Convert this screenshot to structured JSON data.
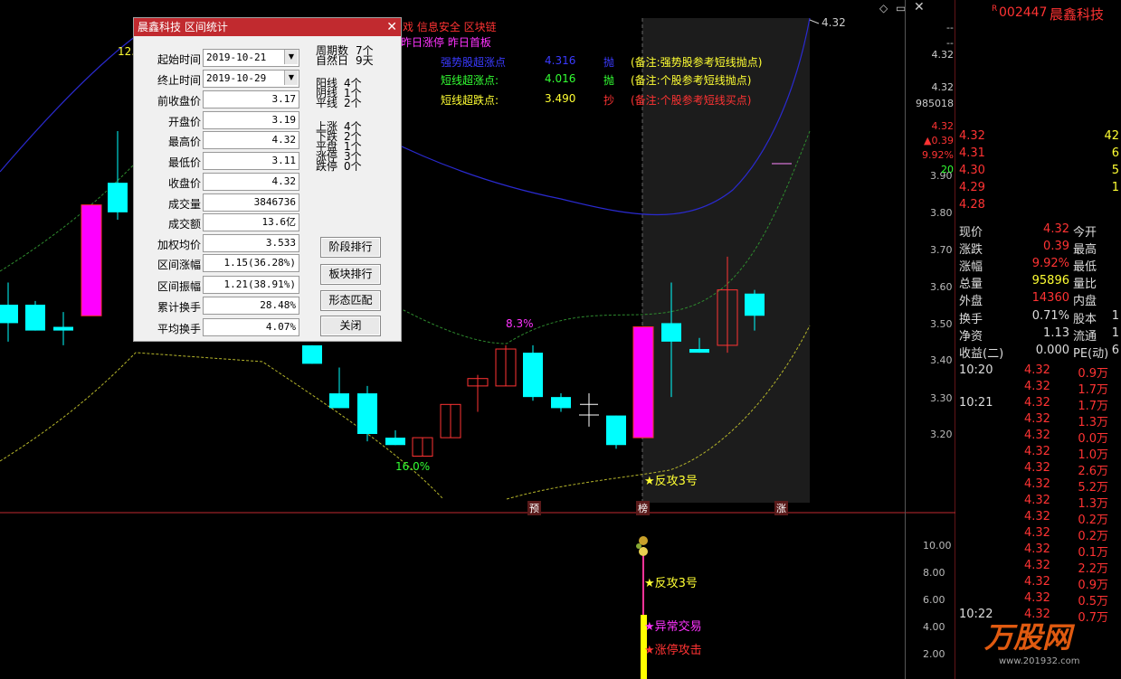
{
  "top_tags": {
    "line1": "戏 信息安全 区块链",
    "line2": "昨日涨停 昨日首板",
    "corner_icons": [
      "diamond-icon",
      "window-icon",
      "close-icon"
    ]
  },
  "signals": [
    {
      "name": "强势股超涨点",
      "value": "4.316",
      "action": "抛",
      "note": "(备注:强势股参考短线抛点)",
      "color": "#3a3aff",
      "note_color": "#ffff33"
    },
    {
      "name": "短线超涨点:",
      "value": "4.016",
      "action": "抛",
      "note": "(备注:个股参考短线抛点)",
      "color": "#33ff33",
      "note_color": "#ffff33"
    },
    {
      "name": "短线超跌点:",
      "value": "3.490",
      "action": "抄",
      "note": "(备注:个股参考短线买点)",
      "color": "#ffff33",
      "note_color": "#ff3333"
    }
  ],
  "dialog": {
    "title": "晨鑫科技 区间统计",
    "fields": [
      {
        "label": "起始时间",
        "value": "2019-10-21",
        "dropdown": true
      },
      {
        "label": "终止时间",
        "value": "2019-10-29",
        "dropdown": true
      },
      {
        "label": "前收盘价",
        "value": "3.17"
      },
      {
        "label": "开盘价",
        "value": "3.19"
      },
      {
        "label": "最高价",
        "value": "4.32"
      },
      {
        "label": "最低价",
        "value": "3.11"
      },
      {
        "label": "收盘价",
        "value": "4.32"
      },
      {
        "label": "成交量",
        "value": "3846736"
      },
      {
        "label": "成交额",
        "value": "13.6亿"
      },
      {
        "label": "加权均价",
        "value": "3.533"
      },
      {
        "label": "区间涨幅",
        "value": "1.15(36.28%)"
      },
      {
        "label": "区间振幅",
        "value": "1.21(38.91%)"
      },
      {
        "label": "累计换手",
        "value": "28.48%"
      },
      {
        "label": "平均换手",
        "value": "4.07%"
      }
    ],
    "stats": [
      [
        "周期数",
        "7个"
      ],
      [
        "自然日",
        "9天"
      ],
      [
        "阳线",
        "4个"
      ],
      [
        "阴线",
        "1个"
      ],
      [
        "平线",
        "2个"
      ],
      [
        "上涨",
        "4个"
      ],
      [
        "下跌",
        "2个"
      ],
      [
        "平盘",
        "1个"
      ],
      [
        "涨停",
        "3个"
      ],
      [
        "跌停",
        "0个"
      ]
    ],
    "buttons": [
      "阶段排行",
      "板块排行",
      "形态匹配",
      "关闭"
    ]
  },
  "chart_labels": {
    "pct_high": "8.3%",
    "pct_low": "16.0%",
    "left_top": "12.",
    "fangong": "★反攻3号",
    "price_top": "4.32",
    "markers": [
      "预",
      "榜",
      "涨"
    ]
  },
  "lower_labels": [
    "★反攻3号",
    "★异常交易",
    "★涨停攻击"
  ],
  "y_axis": [
    "3.90",
    "3.80",
    "3.70",
    "3.60",
    "3.50",
    "3.40",
    "3.30",
    "3.20"
  ],
  "vol_axis": [
    "10.00",
    "8.00",
    "6.00",
    "4.00",
    "2.00"
  ],
  "stock": {
    "code": "002447",
    "name": "晨鑫科技",
    "r": "R"
  },
  "quote_side": {
    "price": "4.32",
    "dashes": [
      "--",
      "--"
    ],
    "prev": "4.32",
    "vol": "985018",
    "last": "4.32",
    "chg": "▲0.39",
    "pct": "9.92%",
    "num": "20"
  },
  "order_book": [
    {
      "price": "4.32",
      "qty": "42"
    },
    {
      "price": "4.31",
      "qty": "6"
    },
    {
      "price": "4.30",
      "qty": "5"
    },
    {
      "price": "4.29",
      "qty": "1"
    },
    {
      "price": "4.28",
      "qty": ""
    }
  ],
  "quote_table": [
    {
      "l1": "现价",
      "v1": "4.32",
      "l2": "今开",
      "v1c": "#ff3333"
    },
    {
      "l1": "涨跌",
      "v1": "0.39",
      "l2": "最高",
      "v1c": "#ff3333"
    },
    {
      "l1": "涨幅",
      "v1": "9.92%",
      "l2": "最低",
      "v1c": "#ff3333"
    },
    {
      "l1": "总量",
      "v1": "95896",
      "l2": "量比",
      "v1c": "#ffff33"
    },
    {
      "l1": "外盘",
      "v1": "14360",
      "l2": "内盘",
      "v1c": "#ff3333"
    }
  ],
  "quote_table2": [
    {
      "l1": "换手",
      "v1": "0.71%",
      "l2": "股本",
      "v2": "1"
    },
    {
      "l1": "净资",
      "v1": "1.13",
      "l2": "流通",
      "v2": "1"
    },
    {
      "l1": "收益(二)",
      "v1": "0.000",
      "l2": "PE(动)",
      "v2": "6"
    }
  ],
  "ticks": [
    {
      "time": "10:20",
      "price": "4.32",
      "vol": "0.9万"
    },
    {
      "time": "",
      "price": "4.32",
      "vol": "1.7万"
    },
    {
      "time": "10:21",
      "price": "4.32",
      "vol": "1.7万"
    },
    {
      "time": "",
      "price": "4.32",
      "vol": "1.3万"
    },
    {
      "time": "",
      "price": "4.32",
      "vol": "0.0万"
    },
    {
      "time": "",
      "price": "4.32",
      "vol": "1.0万"
    },
    {
      "time": "",
      "price": "4.32",
      "vol": "2.6万"
    },
    {
      "time": "",
      "price": "4.32",
      "vol": "5.2万"
    },
    {
      "time": "",
      "price": "4.32",
      "vol": "1.3万"
    },
    {
      "time": "",
      "price": "4.32",
      "vol": "0.2万"
    },
    {
      "time": "",
      "price": "4.32",
      "vol": "0.2万"
    },
    {
      "time": "",
      "price": "4.32",
      "vol": "0.1万"
    },
    {
      "time": "",
      "price": "4.32",
      "vol": "2.2万"
    },
    {
      "time": "",
      "price": "4.32",
      "vol": "0.9万"
    },
    {
      "time": "",
      "price": "4.32",
      "vol": "0.5万"
    },
    {
      "time": "10:22",
      "price": "4.32",
      "vol": "0.7万"
    }
  ],
  "watermark": {
    "text": "万股网",
    "url": "www.201932.com"
  },
  "colors": {
    "up": "#ff3333",
    "down": "#00ffff",
    "bg": "#000000",
    "accent": "#c12a2f"
  }
}
